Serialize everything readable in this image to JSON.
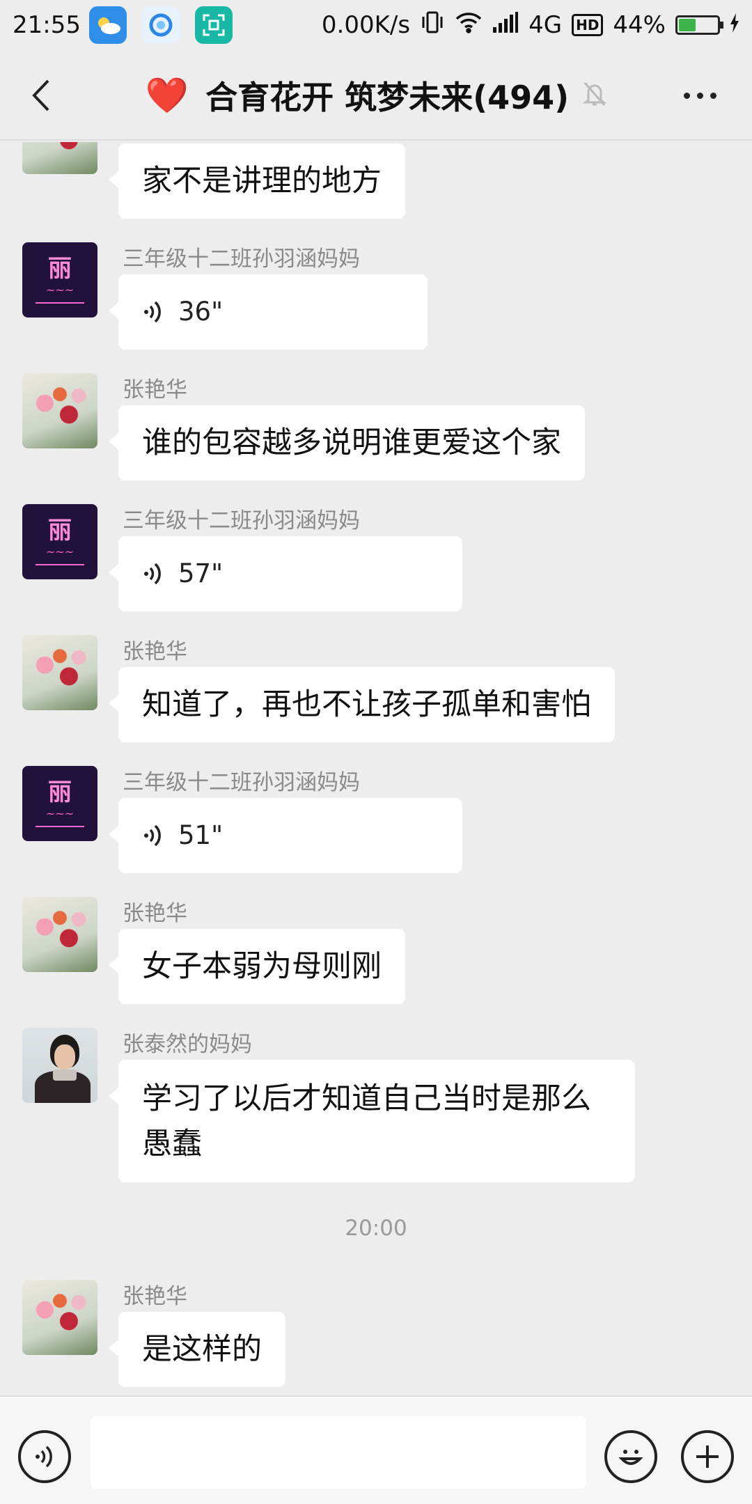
{
  "status_bar": {
    "time": "21:55",
    "net_speed": "0.00K/s",
    "network": "4G",
    "hd": "HD",
    "battery": "44%",
    "battery_level": 0.44,
    "icons": [
      "weather-app-icon",
      "browser-app-icon",
      "scanner-app-icon",
      "vibrate-icon",
      "wifi-icon",
      "signal-icon",
      "battery-icon",
      "charging-icon"
    ]
  },
  "header": {
    "title_emoji": "❤️",
    "title": "合育花开 筑梦未来(494)",
    "icons": [
      "back-icon",
      "heart-icon",
      "mute-bell-icon",
      "more-icon"
    ]
  },
  "messages": [
    {
      "sender": "",
      "type": "text",
      "text": "家不是讲理的地方",
      "avatar": "flower"
    },
    {
      "sender": "三年级十二班孙羽涵妈妈",
      "type": "voice",
      "duration": "36\"",
      "avatar": "neon",
      "avatar_text": "丽"
    },
    {
      "sender": "张艳华",
      "type": "text",
      "text": "谁的包容越多说明谁更爱这个家",
      "avatar": "flower"
    },
    {
      "sender": "三年级十二班孙羽涵妈妈",
      "type": "voice",
      "duration": "57\"",
      "avatar": "neon",
      "avatar_text": "丽"
    },
    {
      "sender": "张艳华",
      "type": "text",
      "text": "知道了，再也不让孩子孤单和害怕",
      "avatar": "flower"
    },
    {
      "sender": "三年级十二班孙羽涵妈妈",
      "type": "voice",
      "duration": "51\"",
      "avatar": "neon",
      "avatar_text": "丽"
    },
    {
      "sender": "张艳华",
      "type": "text",
      "text": "女子本弱为母则刚",
      "avatar": "flower"
    },
    {
      "sender": "张泰然的妈妈",
      "type": "text",
      "text_line1": "学习了以后才知道自己当时是那么",
      "text_line2": "愚蠢",
      "avatar": "woman"
    },
    {
      "sender": "张艳华",
      "type": "text",
      "text": "是这样的",
      "avatar": "flower"
    }
  ],
  "time_separator": "20:00",
  "input_bar": {
    "value": "",
    "icons": [
      "voice-toggle-icon",
      "emoji-icon",
      "plus-icon"
    ]
  },
  "colors": {
    "chat_bg": "#ededed",
    "bubble": "#ffffff",
    "heart": "#e0242e",
    "battery_green": "#3cb24a"
  }
}
